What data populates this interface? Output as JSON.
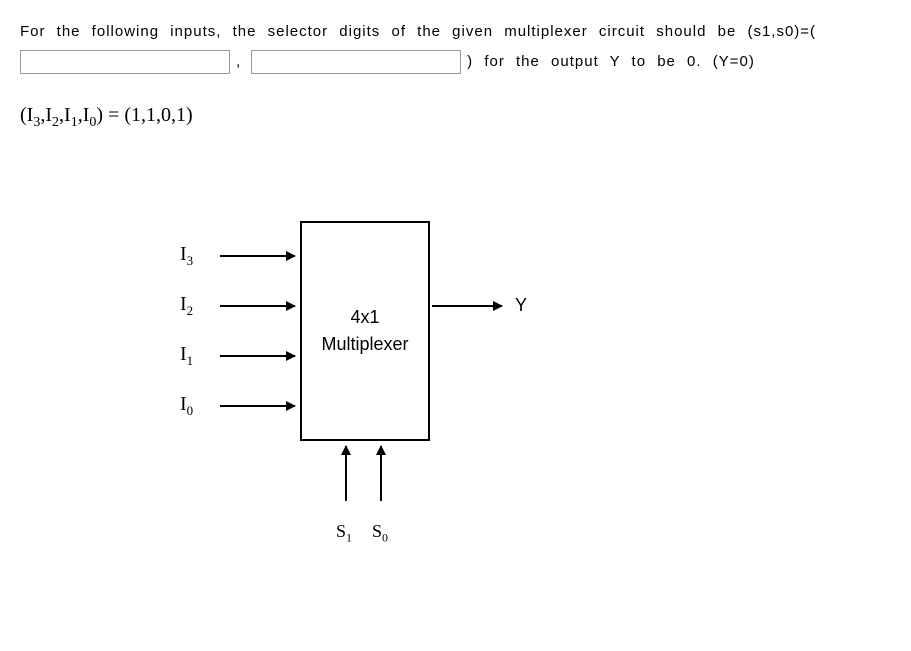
{
  "question": {
    "part1": "For the following inputs, the selector digits of the given multiplexer circuit should be (s1,s0)=(",
    "comma": ",",
    "part2": ") for the output Y to be 0. (Y=0)"
  },
  "equation": {
    "lparen": "(",
    "I": "I",
    "s3": "3",
    "c1": ",",
    "s2": "2",
    "c2": ",",
    "s1": "1",
    "c3": ",",
    "s0": "0",
    "rparen": ")",
    "eq": " = ",
    "rhs": "(1,1,0,1)"
  },
  "diagram": {
    "inputs": {
      "I": "I",
      "i3": "3",
      "i2": "2",
      "i1": "1",
      "i0": "0"
    },
    "mux": {
      "line1": "4x1",
      "line2": "Multiplexer"
    },
    "output": "Y",
    "selectors": {
      "S": "S",
      "s1": "1",
      "s0": "0"
    }
  }
}
